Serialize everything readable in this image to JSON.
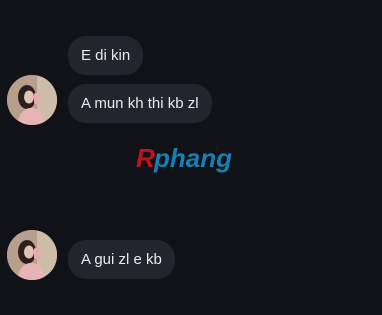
{
  "messages": [
    {
      "text": "E di kin"
    },
    {
      "text": "A mun kh thi kb zl"
    },
    {
      "text": "A gui zl e kb"
    }
  ],
  "watermark": {
    "prefix": "R",
    "rest": "phang",
    "prefix_color": "#c0121c",
    "rest_color": "#167fb3"
  },
  "colors": {
    "background": "#111217",
    "bubble": "#23252d",
    "text": "#e9eaee"
  }
}
